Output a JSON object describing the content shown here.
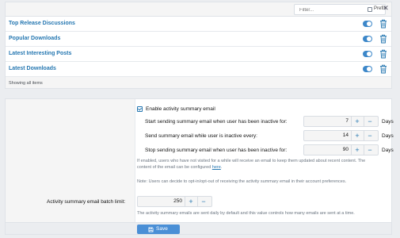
{
  "filter": {
    "placeholder": "Filter...",
    "prefix_label": "Prefix",
    "clear_glyph": "✕"
  },
  "list": {
    "items": [
      {
        "label": "Top Release Discussions"
      },
      {
        "label": "Popular Downloads"
      },
      {
        "label": "Latest Interesting Posts"
      },
      {
        "label": "Latest Downloads"
      }
    ],
    "footer": "Showing all items"
  },
  "options": {
    "enable_label": "Enable activity summary email",
    "rows": [
      {
        "label": "Start sending summary email when user has been inactive for:",
        "value": "7",
        "unit": "Days"
      },
      {
        "label": "Send summary email while user is inactive every:",
        "value": "14",
        "unit": "Days"
      },
      {
        "label": "Stop sending summary email when user has been inactive for:",
        "value": "90",
        "unit": "Days"
      }
    ],
    "hint1_a": "If enabled, users who have not visited for a while will receive an email to keep them updated about recent content. The",
    "hint1_b": "content of the email can be configured",
    "hint1_link": "here",
    "hint1_end": ".",
    "hint2": "Note: Users can decide to opt-in/opt-out of receiving the activity summary email in their account preferences.",
    "batch_label": "Activity summary email batch limit:",
    "batch_value": "250",
    "batch_hint": "The activity summary emails are sent daily by default and this value controls how many emails are sent at a time.",
    "plus": "+",
    "minus": "−",
    "save_label": "Save"
  },
  "icons": {
    "toggle": "toggle-on-icon",
    "delete": "trash-icon",
    "save": "save-icon"
  },
  "colors": {
    "accent": "#2577b1",
    "toggle": "#3c87c9",
    "button": "#4a8fd6"
  }
}
